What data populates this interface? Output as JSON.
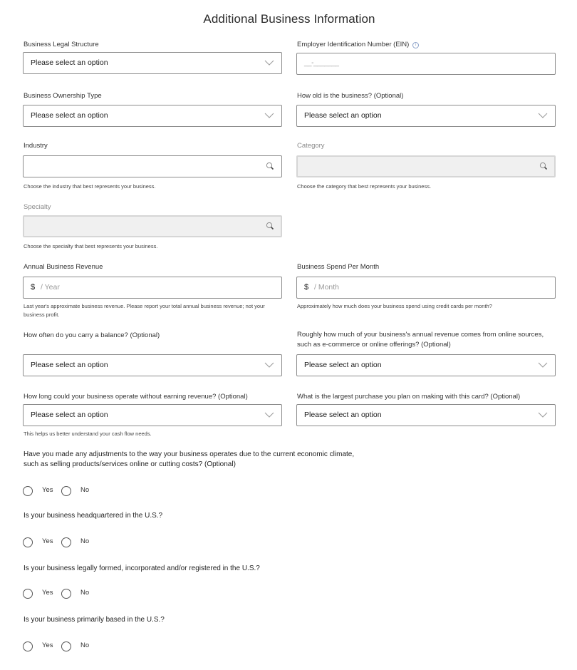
{
  "page": {
    "title": "Additional Business Information"
  },
  "fields": {
    "legal_structure": {
      "label": "Business Legal Structure",
      "value": "Please select an option"
    },
    "ein": {
      "label": "Employer Identification Number (EIN)",
      "mask": "__-_______",
      "info_icon": "info-icon"
    },
    "ownership_type": {
      "label": "Business Ownership Type",
      "value": "Please select an option"
    },
    "business_age": {
      "label": "How old is the business? (Optional)",
      "value": "Please select an option"
    },
    "industry": {
      "label": "Industry",
      "value": "",
      "help": "Choose the industry that best represents your business."
    },
    "category": {
      "label": "Category",
      "value": "",
      "help": "Choose the category that best represents your business.",
      "disabled": true
    },
    "specialty": {
      "label": "Specialty",
      "value": "",
      "help": "Choose the specialty that best represents your business.",
      "disabled": true
    },
    "annual_revenue": {
      "label": "Annual Business Revenue",
      "prefix": "$",
      "placeholder": "/ Year",
      "help": "Last year's approximate business revenue. Please report your total annual business revenue; not your business profit."
    },
    "monthly_spend": {
      "label": "Business Spend Per Month",
      "prefix": "$",
      "placeholder": "/ Month",
      "help": "Approximately how much does your business spend using credit cards per month?"
    },
    "carry_balance": {
      "label": "How often do you carry a balance? (Optional)",
      "value": "Please select an option"
    },
    "online_revenue": {
      "label": "Roughly how much of your business's annual revenue comes from online sources, such as e-commerce or online offerings? (Optional)",
      "value": "Please select an option"
    },
    "operate_without_revenue": {
      "label": "How long could your business operate without earning revenue? (Optional)",
      "value": "Please select an option",
      "help": "This helps us better understand your cash flow needs."
    },
    "largest_purchase": {
      "label": "What is the largest purchase you plan on making with this card? (Optional)",
      "value": "Please select an option"
    }
  },
  "questions": [
    {
      "text": "Have you made any adjustments to the way your business operates due to the current economic climate, such as selling products/services online or cutting costs? (Optional)",
      "options": [
        "Yes",
        "No"
      ],
      "selected": null
    },
    {
      "text": "Is your business headquartered in the U.S.?",
      "options": [
        "Yes",
        "No"
      ],
      "selected": null
    },
    {
      "text": "Is your business legally formed, incorporated and/or registered in the U.S.?",
      "options": [
        "Yes",
        "No"
      ],
      "selected": null
    },
    {
      "text": "Is your business primarily based in the U.S.?",
      "options": [
        "Yes",
        "No"
      ],
      "selected": null
    }
  ]
}
